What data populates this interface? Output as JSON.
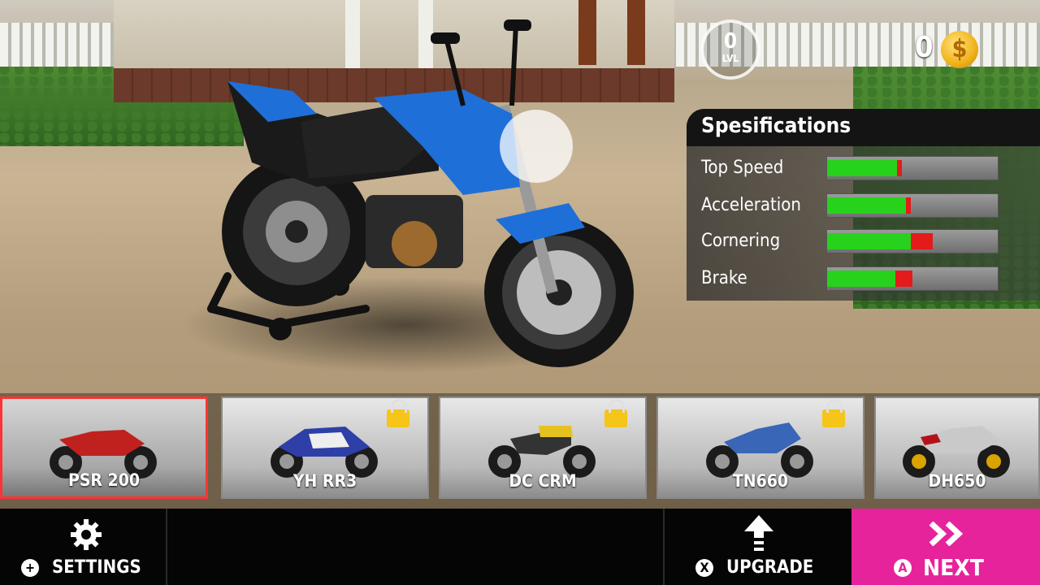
{
  "hud": {
    "level_value": "0",
    "level_label": "LVL",
    "coins": "0",
    "coin_symbol": "$"
  },
  "specs": {
    "title": "Spesifications",
    "rows": [
      {
        "label": "Top Speed",
        "green_pct": 41,
        "red_pct": 44
      },
      {
        "label": "Acceleration",
        "green_pct": 46,
        "red_pct": 49
      },
      {
        "label": "Cornering",
        "green_pct": 49,
        "red_pct": 62
      },
      {
        "label": "Brake",
        "green_pct": 40,
        "red_pct": 50
      }
    ]
  },
  "bikes": [
    {
      "name": "PSR 200",
      "locked": false,
      "selected": true,
      "color": "#c0201e"
    },
    {
      "name": "YH RR3",
      "locked": true,
      "selected": false,
      "color": "#2f3fa8"
    },
    {
      "name": "DC CRM",
      "locked": true,
      "selected": false,
      "color": "#e5c21f"
    },
    {
      "name": "TN660",
      "locked": true,
      "selected": false,
      "color": "#3a66b8"
    },
    {
      "name": "DH650",
      "locked": false,
      "selected": false,
      "color": "#c9c9c9"
    }
  ],
  "buttons": {
    "settings": {
      "label": "SETTINGS",
      "key": "+",
      "icon": "gear-icon"
    },
    "upgrade": {
      "label": "UPGRADE",
      "key": "X",
      "icon": "up-arrow-icon"
    },
    "next": {
      "label": "NEXT",
      "key": "A",
      "icon": "double-chevron-icon"
    }
  },
  "colors": {
    "next_button": "#e6239b",
    "selected_border": "#ff3333",
    "bar_green": "#27d21c",
    "bar_red": "#e31b1b",
    "main_bike": "#1f6fd8"
  }
}
